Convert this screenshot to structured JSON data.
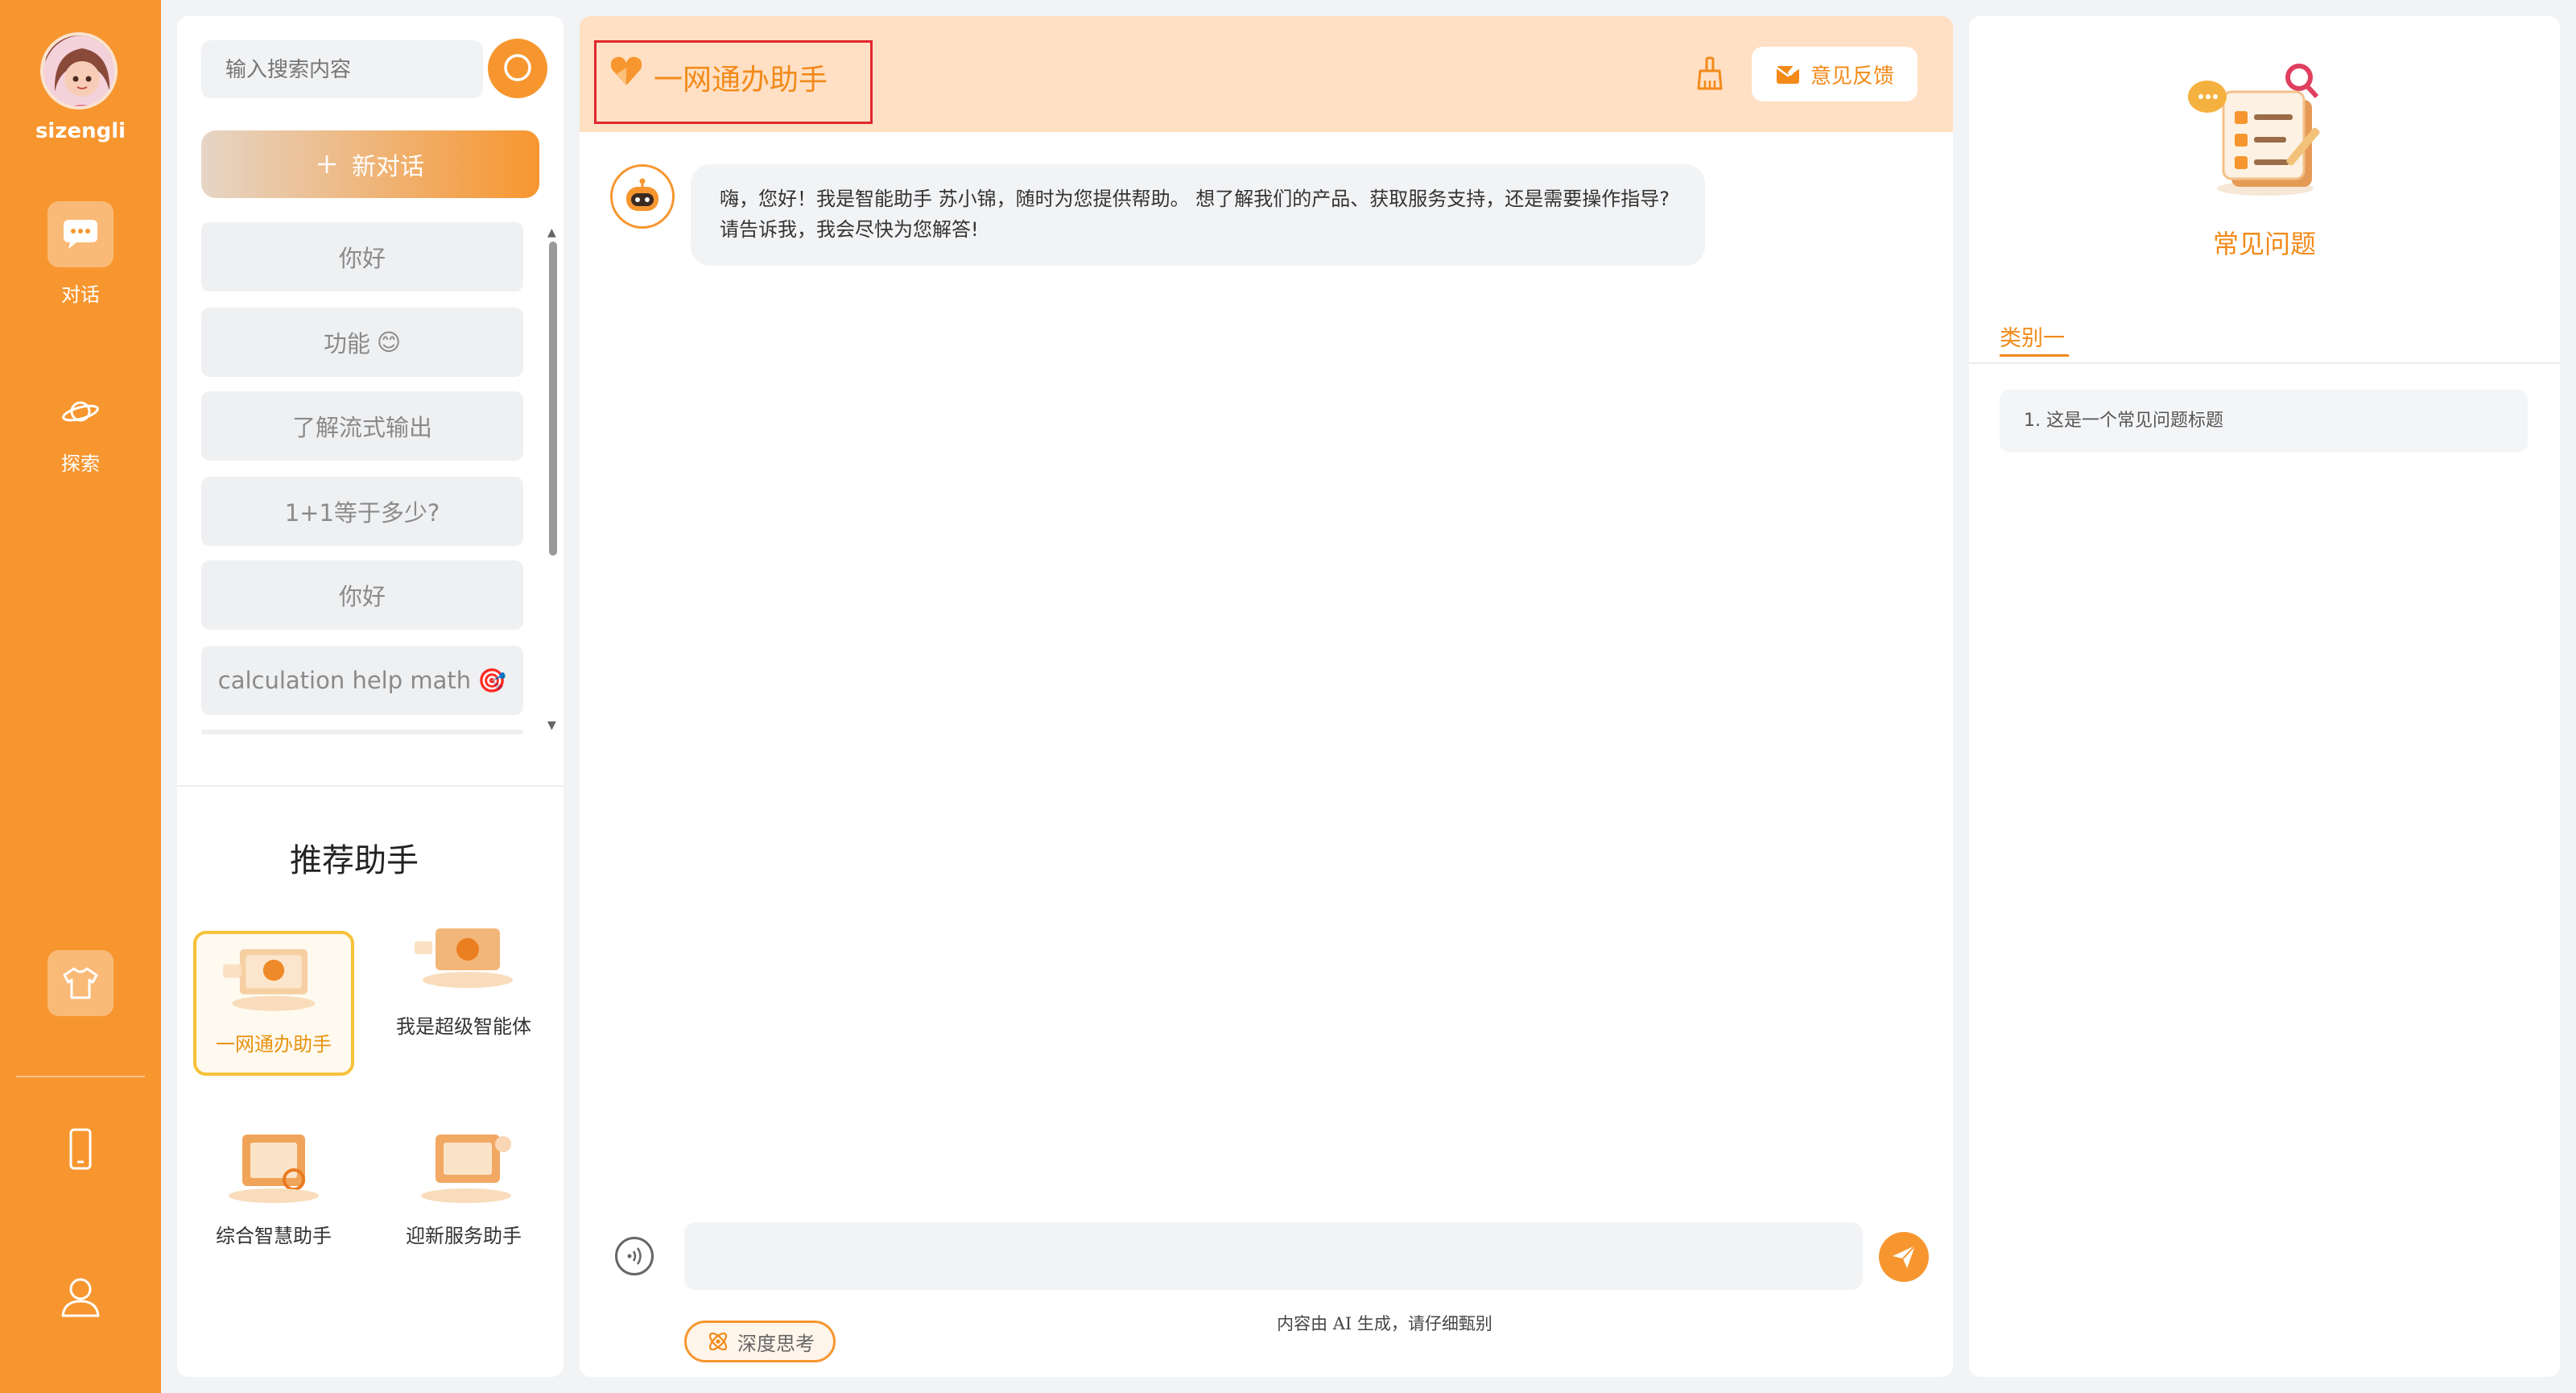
{
  "user": {
    "name": "sizengli"
  },
  "nav": [
    {
      "label": "对话",
      "icon": "chat-icon"
    },
    {
      "label": "探索",
      "icon": "planet-icon"
    }
  ],
  "search": {
    "placeholder": "输入搜索内容"
  },
  "new_chat_label": "新对话",
  "conversations": [
    {
      "label": "你好",
      "emoji": ""
    },
    {
      "label": "功能",
      "emoji": "😊"
    },
    {
      "label": "了解流式输出",
      "emoji": ""
    },
    {
      "label": "1+1等于多少?",
      "emoji": ""
    },
    {
      "label": "你好",
      "emoji": ""
    },
    {
      "label": "calculation help math",
      "emoji": "🎯"
    }
  ],
  "recommend": {
    "title": "推荐助手",
    "assistants": [
      {
        "label": "一网通办助手",
        "active": true
      },
      {
        "label": "我是超级智能体",
        "active": false
      },
      {
        "label": "综合智慧助手",
        "active": false
      },
      {
        "label": "迎新服务助手",
        "active": false
      }
    ]
  },
  "chat": {
    "title": "一网通办助手",
    "feedback_label": "意见反馈",
    "greeting_line1": "嗨，您好！我是智能助手 苏小锦，随时为您提供帮助。 想了解我们的产品、获取服务支持，还是需要操作指导?",
    "greeting_line2": "请告诉我，我会尽快为您解答!",
    "input_value": "",
    "disclaimer": "内容由 AI 生成，请仔细甄别",
    "deep_think_label": "深度思考"
  },
  "faq": {
    "title": "常见问题",
    "tab": "类别一",
    "items": [
      "1. 这是一个常见问题标题"
    ]
  },
  "colors": {
    "accent": "#f7962f",
    "header_bg": "#ffe0c4",
    "highlight_box": "#e0272d"
  }
}
